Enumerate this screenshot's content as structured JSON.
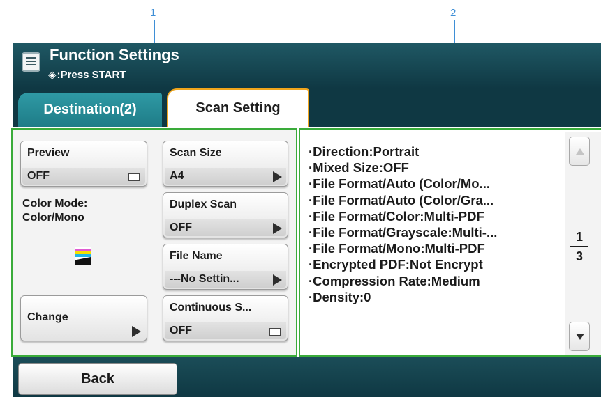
{
  "callouts": {
    "first": "1",
    "second": "2"
  },
  "header": {
    "title": "Function Settings",
    "subtitle_icon": "◈",
    "subtitle": ":Press START"
  },
  "tabs": [
    {
      "label": "Destination(2)",
      "active": false
    },
    {
      "label": "Scan Setting",
      "active": true
    }
  ],
  "left_column": {
    "preview": {
      "label": "Preview",
      "value": "OFF"
    },
    "color_mode": {
      "label_line1": "Color Mode:",
      "label_line2": "Color/Mono"
    },
    "change": {
      "label": "Change"
    }
  },
  "mid_column": {
    "scan_size": {
      "label": "Scan Size",
      "value": "A4"
    },
    "duplex_scan": {
      "label": "Duplex Scan",
      "value": "OFF"
    },
    "file_name": {
      "label": "File Name",
      "value": "---No Settin..."
    },
    "continuous": {
      "label": "Continuous S...",
      "value": "OFF"
    }
  },
  "settings_list": [
    "·Direction:Portrait",
    "·Mixed Size:OFF",
    "·File Format/Auto (Color/Mo...",
    "·File Format/Auto (Color/Gra...",
    "·File Format/Color:Multi-PDF",
    "·File Format/Grayscale:Multi-...",
    "·File Format/Mono:Multi-PDF",
    "·Encrypted PDF:Not Encrypt",
    "·Compression Rate:Medium",
    "·Density:0"
  ],
  "pager": {
    "current": "1",
    "total": "3"
  },
  "bottom": {
    "back_label": "Back"
  },
  "colors": {
    "header_bg": "#0f3843",
    "tab_inactive": "#1e7c87",
    "tab_active_border": "#f0a51c",
    "callout_blue": "#3f8fd6",
    "callout_green": "#3aab3a"
  }
}
